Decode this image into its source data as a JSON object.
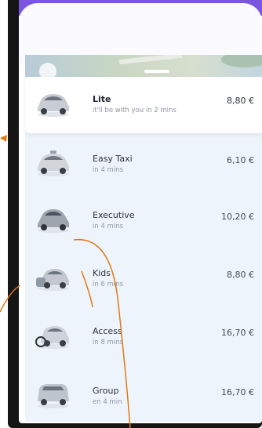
{
  "rides": [
    {
      "name": "Lite",
      "subtitle": "it'll be with you in 2 mins",
      "price": "8,80 €",
      "selected": true
    },
    {
      "name": "Easy Taxi",
      "subtitle": "in 4 mins",
      "price": "6,10 €",
      "selected": false
    },
    {
      "name": "Executive",
      "subtitle": "in 4 mins",
      "price": "10,20 €",
      "selected": false
    },
    {
      "name": "Kids",
      "subtitle": "in 6 mins",
      "price": "8,80 €",
      "selected": false
    },
    {
      "name": "Access",
      "subtitle": "in 8 mins",
      "price": "16,70 €",
      "selected": false
    },
    {
      "name": "Group",
      "subtitle": "en 4 min",
      "price": "16,70 €",
      "selected": false
    }
  ],
  "colors": {
    "accent": "#7a55e0",
    "annotation": "#e07a12",
    "list_bg": "#eef4fb"
  }
}
